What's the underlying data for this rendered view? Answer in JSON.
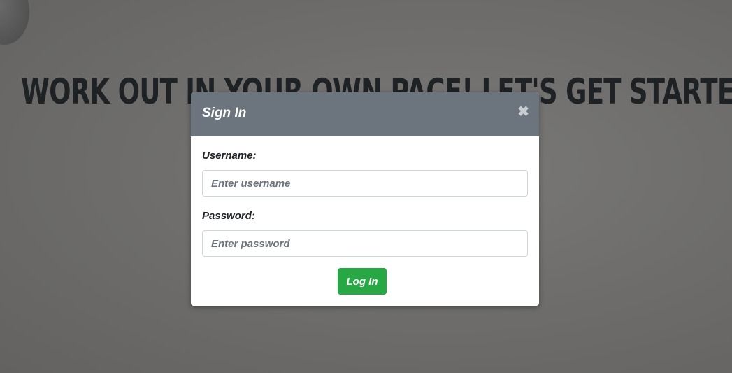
{
  "page": {
    "headline": "Work out in your own pace! Let's get started!"
  },
  "modal": {
    "title": "Sign In",
    "close_glyph": "✖",
    "username_label": "Username:",
    "username_placeholder": "Enter username",
    "username_value": "",
    "password_label": "Password:",
    "password_placeholder": "Enter password",
    "password_value": "",
    "submit_label": "Log In"
  },
  "colors": {
    "header_bg": "#6c757d",
    "submit_bg": "#28a745",
    "headline": "#1f2225"
  },
  "icons": {
    "close": "close-icon"
  }
}
